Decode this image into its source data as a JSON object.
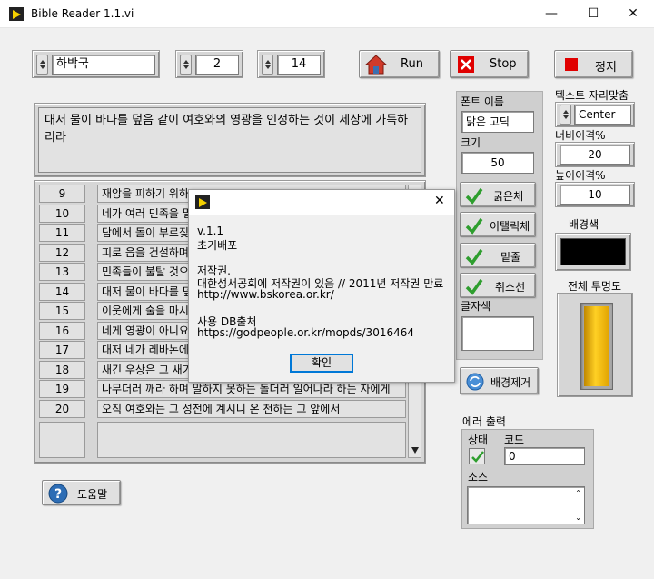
{
  "window": {
    "title": "Bible Reader 1.1.vi",
    "minimize": "—",
    "maximize": "☐",
    "close": "✕"
  },
  "selector": {
    "book": "하박국",
    "chapter": "2",
    "verse": "14"
  },
  "toolbar": {
    "run_label": "Run",
    "stop_label": "Stop",
    "halt_label": "정지"
  },
  "verse_text": "대저 물이 바다를 덮음 같이 여호와의 영광을 인정하는 것이 세상에 가득하리라",
  "list": {
    "numbers": [
      "9",
      "10",
      "11",
      "12",
      "13",
      "14",
      "15",
      "16",
      "17",
      "18",
      "19",
      "20"
    ],
    "rows": [
      "재앙을 피하기 위하",
      "네가 여러 민족을 멸",
      "담에서 돌이 부르짖",
      "피로 읍을 건설하며",
      "민족들이 불탈 것으",
      "대저 물이 바다를 덮",
      "이웃에게 술을 마시",
      "네게 영광이 아니요",
      "대저 네가 레바논에",
      "새긴 우상은 그 새기",
      "나무더러 깨라 하며 말하지 못하는 돌더러 일어나라 하는 자에게",
      "오직 여호와는 그 성전에 계시니 온 천하는 그 앞에서"
    ]
  },
  "font_panel": {
    "font_name_label": "폰트 이름",
    "font_name_value": "맑은 고딕",
    "size_label": "크기",
    "size_value": "50",
    "bold_label": "굵은체",
    "italic_label": "이탤릭체",
    "underline_label": "밑줄",
    "strike_label": "취소선",
    "text_color_label": "글자색",
    "remove_bg_label": "배경제거"
  },
  "right_panel": {
    "align_label": "텍스트 자리맞춤",
    "align_value": "Center",
    "width_label": "너비이격%",
    "width_value": "20",
    "height_label": "높이이격%",
    "height_value": "10",
    "bg_color_label": "배경색",
    "opacity_label": "전체 투명도"
  },
  "error_out": {
    "title": "에러 출력",
    "status_label": "상태",
    "code_label": "코드",
    "code_value": "0",
    "source_label": "소스"
  },
  "help_label": "도움말",
  "dialog": {
    "lines": [
      "v.1.1",
      "초기배포",
      "",
      "저작권.",
      "대한성서공회에 저작권이 있음 // 2011년 저작권 만료",
      "http://www.bskorea.or.kr/",
      "",
      "사용 DB출처",
      "https://godpeople.or.kr/mopds/3016464"
    ],
    "ok_label": "확인",
    "close": "✕"
  },
  "colors": {
    "stop_red": "#e00000",
    "check_green": "#2e9e2e",
    "opacity_gold": "#f2b800",
    "bg_swatch": "#000000"
  }
}
